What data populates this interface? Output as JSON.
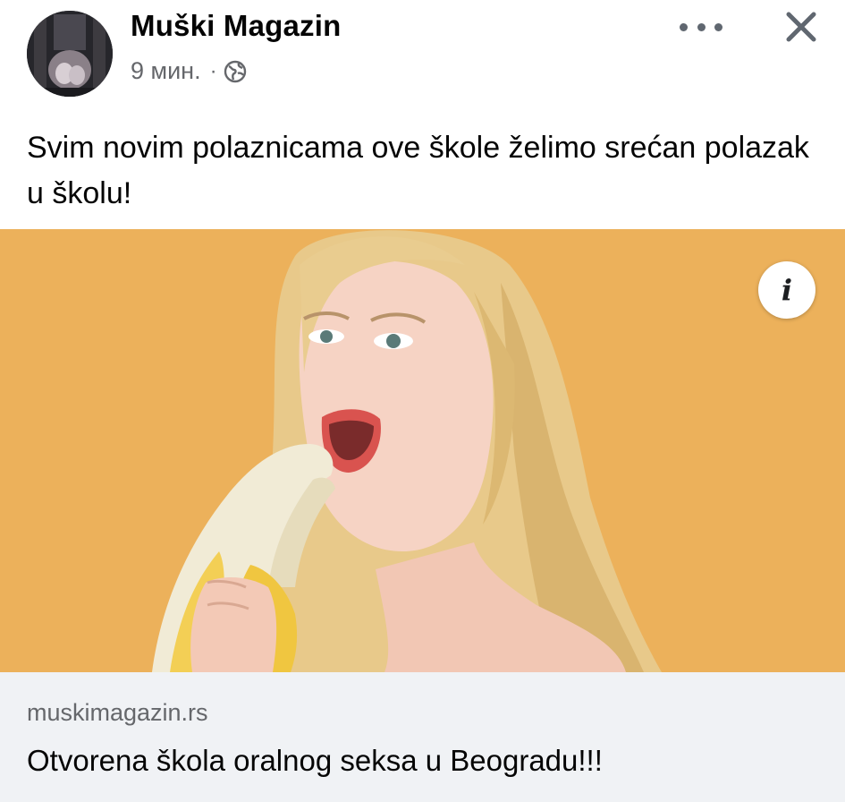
{
  "post": {
    "page_name": "Muški Magazin",
    "time": "9 мин.",
    "separator": "·",
    "privacy_icon": "globe-icon",
    "menu_icon": "more-options-icon",
    "close_icon": "close-icon",
    "text": "Svim novim polaznicama ove škole želimo srećan polazak u školu!",
    "image_info_icon": "info-icon",
    "image_info_glyph": "i"
  },
  "link_preview": {
    "domain": "muskimagazin.rs",
    "title": "Otvorena škola oralnog seksa u Beogradu!!!"
  },
  "colors": {
    "image_background": "#ecb15b",
    "link_box_background": "#f0f2f5",
    "secondary_text": "#65676b"
  }
}
